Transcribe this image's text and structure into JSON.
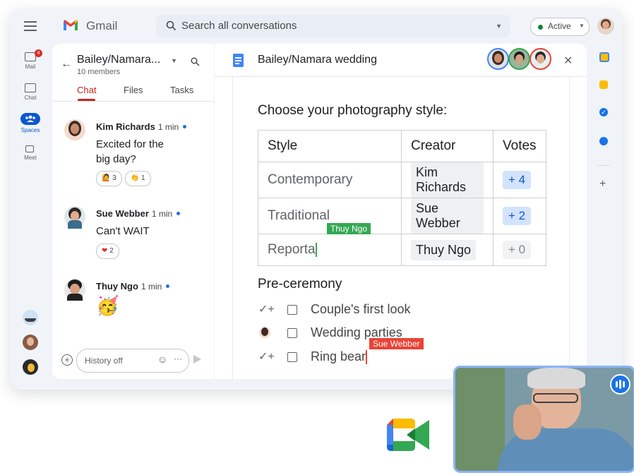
{
  "app": {
    "name": "Gmail",
    "colors": {
      "gmail_red": "#ea4335",
      "blue": "#4285f4",
      "yellow": "#fbbc04",
      "green": "#34a853",
      "active_green": "#188038",
      "accent_blue": "#0b57d0"
    }
  },
  "header": {
    "search_placeholder": "Search all conversations",
    "status": "Active"
  },
  "rail": {
    "items": [
      {
        "label": "Mail",
        "badge": "4",
        "icon": "mail-icon"
      },
      {
        "label": "Chat",
        "icon": "chat-icon"
      },
      {
        "label": "Spaces",
        "icon": "spaces-icon",
        "active": true
      },
      {
        "label": "Meet",
        "icon": "video-icon"
      }
    ]
  },
  "space": {
    "title": "Bailey/Namara...",
    "members": "10 members",
    "tabs": [
      "Chat",
      "Files",
      "Tasks"
    ],
    "active_tab": "Chat",
    "messages": [
      {
        "name": "Kim Richards",
        "time": "1 min",
        "text_lines": [
          "Excited for the",
          "big day?"
        ],
        "reactions": [
          {
            "emoji": "🙋",
            "count": "3"
          },
          {
            "emoji": "👏",
            "count": "1"
          }
        ]
      },
      {
        "name": "Sue Webber",
        "time": "1 min",
        "text_lines": [
          "Can't WAIT"
        ],
        "reactions": [
          {
            "emoji": "❤",
            "count": "2"
          }
        ]
      },
      {
        "name": "Thuy Ngo",
        "time": "1 min",
        "emoji": "🥳"
      }
    ],
    "compose": {
      "placeholder": "History off"
    }
  },
  "doc": {
    "title": "Bailey/Namara wedding",
    "heading": "Choose your photography style:",
    "table": {
      "headers": [
        "Style",
        "Creator",
        "Votes"
      ],
      "rows": [
        {
          "style": "Contemporary",
          "creator": "Kim Richards",
          "votes": "+ 4",
          "voted": true
        },
        {
          "style": "Traditional",
          "creator": "Sue Webber",
          "votes": "+ 2",
          "voted": true
        },
        {
          "style": "Reporta",
          "creator": "Thuy Ngo",
          "votes": "+ 0",
          "voted": false
        }
      ]
    },
    "cursor_tags": [
      {
        "name": "Thuy Ngo",
        "color": "#34a853"
      },
      {
        "name": "Sue Webber",
        "color": "#ea4335"
      }
    ],
    "section2": "Pre-ceremony",
    "tasks": [
      "Couple's first look",
      "Wedding parties",
      "Ring bear"
    ]
  }
}
